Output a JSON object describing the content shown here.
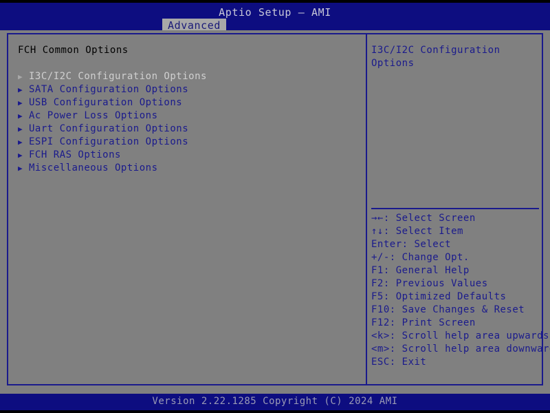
{
  "header": {
    "title": "Aptio Setup – AMI",
    "active_tab": "Advanced",
    "colors": {
      "header_bg": "#0d0d80",
      "body_bg": "#808080",
      "border": "#1a1a8c",
      "text_blue": "#1a1a8c",
      "text_selected": "#d0d0d0",
      "tab_bg": "#a8a8a8"
    }
  },
  "left_panel": {
    "title": "FCH Common Options",
    "menu_items": [
      {
        "label": "I3C/I2C Configuration Options",
        "caret": "submenu-arrow-icon",
        "selected": true
      },
      {
        "label": "SATA Configuration Options",
        "caret": "submenu-arrow-icon",
        "selected": false
      },
      {
        "label": "USB Configuration Options",
        "caret": "submenu-arrow-icon",
        "selected": false
      },
      {
        "label": "Ac Power Loss Options",
        "caret": "submenu-arrow-icon",
        "selected": false
      },
      {
        "label": "Uart Configuration Options",
        "caret": "submenu-arrow-icon",
        "selected": false
      },
      {
        "label": "ESPI Configuration Options",
        "caret": "submenu-arrow-icon",
        "selected": false
      },
      {
        "label": "FCH RAS Options",
        "caret": "submenu-arrow-icon",
        "selected": false
      },
      {
        "label": "Miscellaneous Options",
        "caret": "submenu-arrow-icon",
        "selected": false
      }
    ]
  },
  "right_panel": {
    "help_text": "I3C/I2C Configuration Options",
    "legend": [
      "→←: Select Screen",
      "↑↓: Select Item",
      "Enter: Select",
      "+/-: Change Opt.",
      "F1: General Help",
      "F2: Previous Values",
      "F5: Optimized Defaults",
      "F10: Save Changes & Reset",
      "F12: Print Screen",
      "<k>: Scroll help area upwards",
      "<m>: Scroll help area downwards",
      "ESC: Exit"
    ]
  },
  "footer": {
    "version_text": "Version 2.22.1285 Copyright (C) 2024 AMI"
  }
}
